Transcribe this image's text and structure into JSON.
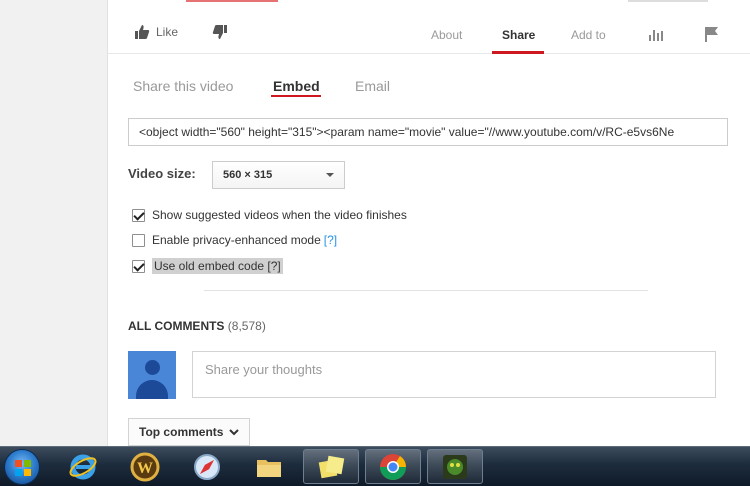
{
  "action_bar": {
    "like_label": "Like",
    "tabs": [
      "About",
      "Share",
      "Add to"
    ],
    "active_tab": "Share"
  },
  "share": {
    "subtabs": [
      "Share this video",
      "Embed",
      "Email"
    ],
    "active_subtab": "Embed",
    "embed_code": "<object width=\"560\" height=\"315\"><param name=\"movie\" value=\"//www.youtube.com/v/RC-e5vs6Ne",
    "video_size_label": "Video size:",
    "video_size_value": "560 × 315",
    "options": [
      {
        "label": "Show suggested videos when the video finishes",
        "checked": true,
        "help": ""
      },
      {
        "label": "Enable privacy-enhanced mode",
        "checked": false,
        "help": "[?]"
      },
      {
        "label": "Use old embed code",
        "checked": true,
        "help": "[?]"
      }
    ]
  },
  "comments": {
    "title": "ALL COMMENTS",
    "count": "(8,578)",
    "placeholder": "Share your thoughts",
    "sort_label": "Top comments"
  },
  "taskbar": {
    "icons": [
      "start-orb",
      "internet-explorer-icon",
      "world-of-warcraft-icon",
      "safari-icon",
      "file-explorer-icon",
      "sticky-notes-icon",
      "chrome-icon",
      "game-icon"
    ]
  },
  "colors": {
    "accent_red": "#cc181e",
    "link_blue": "#2793e6",
    "avatar_blue": "#4a86d8"
  }
}
